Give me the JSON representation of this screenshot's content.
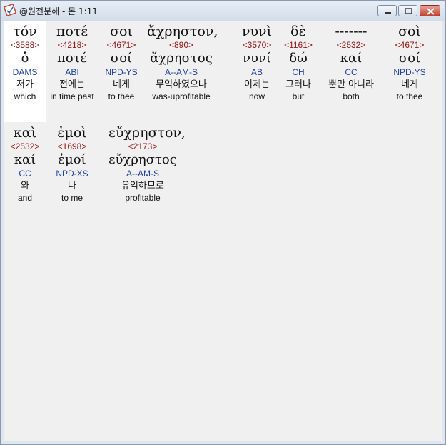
{
  "window": {
    "title": "@원전분해 - 몬 1:11",
    "icon": "app-logo-icon",
    "buttons": [
      "minimize-icon",
      "maximize-icon",
      "close-icon"
    ],
    "accent": "#c2402d"
  },
  "colors": {
    "strong": "#a01414",
    "morph": "#1f3fb0"
  },
  "words": [
    {
      "greek": "τόν",
      "strong": "<3588>",
      "lemma": "ὁ",
      "morph": "DAMS",
      "korean": "저가",
      "english": "which"
    },
    {
      "greek": "ποτέ",
      "strong": "<4218>",
      "lemma": "ποτέ",
      "morph": "ABI",
      "korean": "전에는",
      "english": "in time past"
    },
    {
      "greek": "σοι",
      "strong": "<4671>",
      "lemma": "σοί",
      "morph": "NPD-YS",
      "korean": "네게",
      "english": "to thee"
    },
    {
      "greek": "ἄχρηστον,",
      "strong": "<890>",
      "lemma": "ἄχρηστος",
      "morph": "A--AM-S",
      "korean": "무익하였으나",
      "english": "was-uprofitable"
    },
    {
      "greek": "νυνὶ",
      "strong": "<3570>",
      "lemma": "νυνί",
      "morph": "AB",
      "korean": "이제는",
      "english": "now"
    },
    {
      "greek": "δὲ",
      "strong": "<1161>",
      "lemma": "δώ",
      "morph": "CH",
      "korean": "그러나",
      "english": "but"
    },
    {
      "greek": "-------",
      "strong": "<2532>",
      "lemma": "καί",
      "morph": "CC",
      "korean": "뿐만 아니라",
      "english": "both"
    },
    {
      "greek": "σοὶ",
      "strong": "<4671>",
      "lemma": "σοί",
      "morph": "NPD-YS",
      "korean": "네게",
      "english": "to thee"
    },
    {
      "greek": "καὶ",
      "strong": "<2532>",
      "lemma": "καί",
      "morph": "CC",
      "korean": "와",
      "english": "and"
    },
    {
      "greek": "ἐμοὶ",
      "strong": "<1698>",
      "lemma": "ἐμοί",
      "morph": "NPD-XS",
      "korean": "나",
      "english": "to me"
    },
    {
      "greek": "εὔχρηστον,",
      "strong": "<2173>",
      "lemma": "εὔχρηστος",
      "morph": "A--AM-S",
      "korean": "유익하므로",
      "english": "profitable"
    }
  ]
}
